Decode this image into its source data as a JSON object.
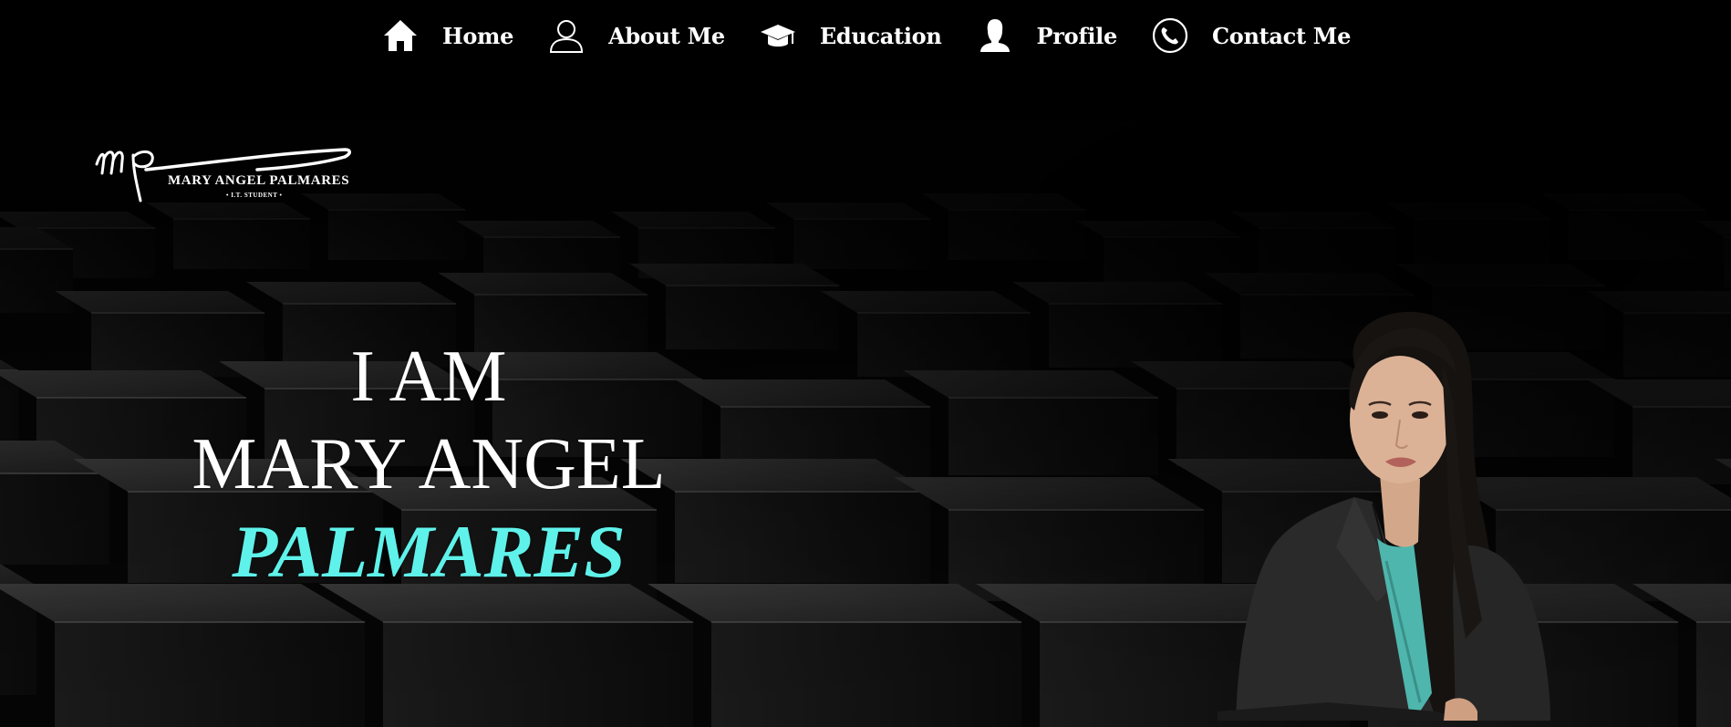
{
  "nav": {
    "items": [
      {
        "icon": "home-icon",
        "label": "Home"
      },
      {
        "icon": "user-outline-icon",
        "label": "About Me"
      },
      {
        "icon": "graduation-cap-icon",
        "label": "Education"
      },
      {
        "icon": "person-silhouette-icon",
        "label": "Profile"
      },
      {
        "icon": "phone-icon",
        "label": "Contact Me"
      }
    ]
  },
  "logo": {
    "monogram": "mp",
    "name": "MARY ANGEL PALMARES",
    "tagline": "• I.T. STUDENT •"
  },
  "hero": {
    "line1": "I AM",
    "line2": "MARY ANGEL",
    "line3": "PALMARES"
  },
  "colors": {
    "background": "#000000",
    "text": "#ffffff",
    "accent": "#5ff2ea"
  }
}
